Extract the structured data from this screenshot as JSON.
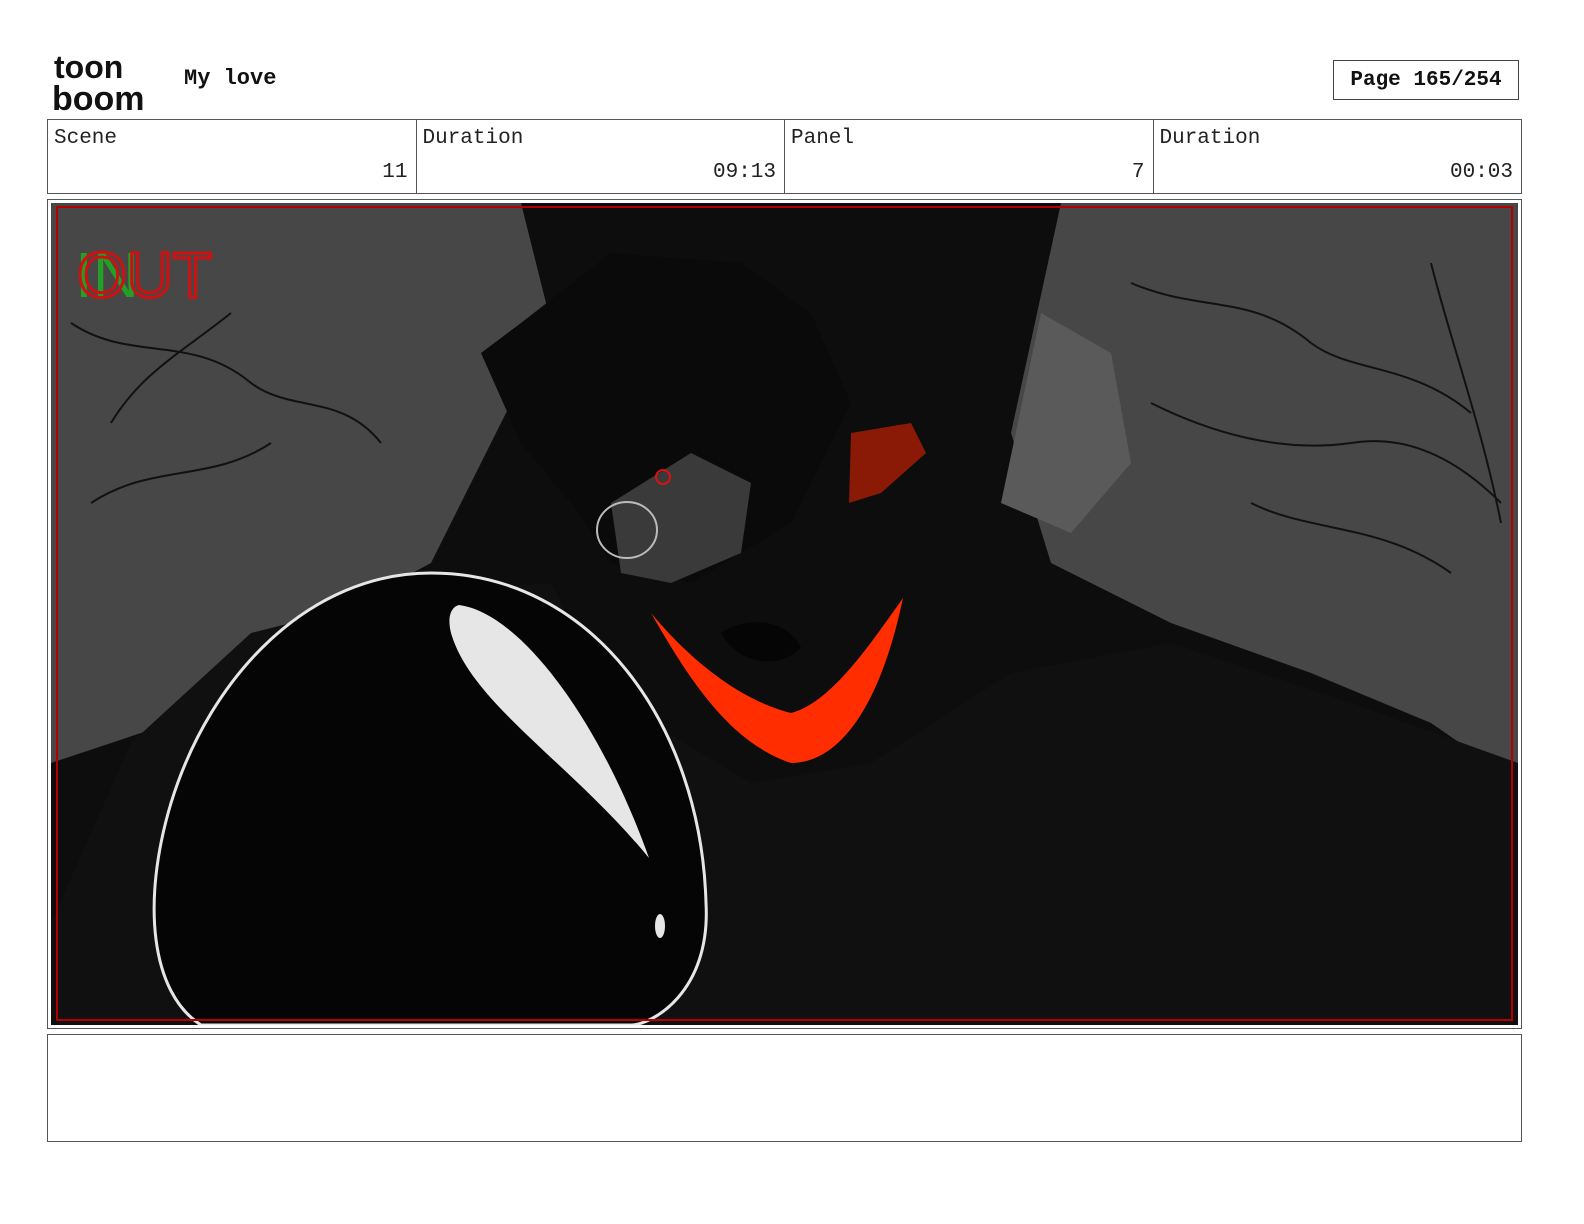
{
  "header": {
    "logo_top": "toon",
    "logo_bottom": "boom",
    "project_title": "My love",
    "page_label": "Page 165/254"
  },
  "info": {
    "scene_label": "Scene",
    "scene_value": "11",
    "scene_duration_label": "Duration",
    "scene_duration_value": "09:13",
    "panel_label": "Panel",
    "panel_value": "7",
    "panel_duration_label": "Duration",
    "panel_duration_value": "00:03"
  },
  "panel": {
    "transition_in": "IN",
    "transition_out": "OUT",
    "colors": {
      "background": "#0d0d0d",
      "wing_gray": "#474747",
      "accent_red": "#ff2d00",
      "dark_red": "#8a1a06",
      "frame_red": "#b00000",
      "in_green": "#1fae1f"
    }
  },
  "notes": {
    "text": ""
  }
}
